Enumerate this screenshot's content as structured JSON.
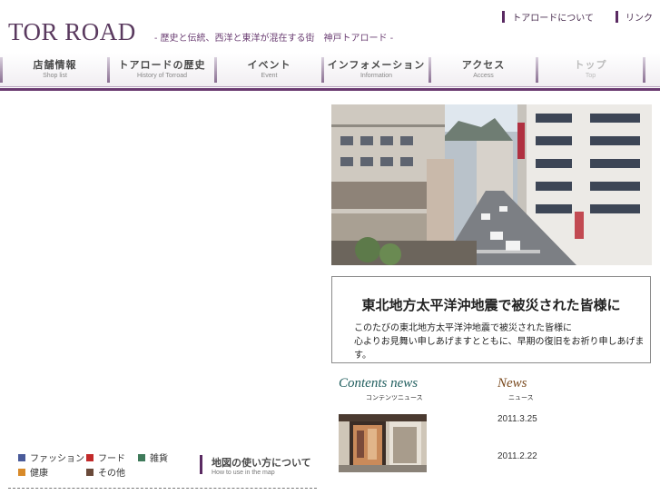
{
  "header": {
    "logo": "TOR ROAD",
    "tagline": "- 歴史と伝統、西洋と東洋が混在する街　神戸トアロード -",
    "links": [
      "トアロードについて",
      "リンク"
    ]
  },
  "nav": [
    {
      "jp": "店舗情報",
      "en": "Shop list"
    },
    {
      "jp": "トアロードの歴史",
      "en": "History of Torroad"
    },
    {
      "jp": "イベント",
      "en": "Event"
    },
    {
      "jp": "インフォメーション",
      "en": "Information"
    },
    {
      "jp": "アクセス",
      "en": "Access"
    },
    {
      "jp": "トップ",
      "en": "Top"
    }
  ],
  "notice": {
    "title": "東北地方太平洋沖地震で被災された皆様に",
    "line1": "このたびの東北地方太平洋沖地震で被災された皆様に",
    "line2": "心よりお見舞い申しあげますとともに、早期の復旧をお祈り申しあげます。"
  },
  "contents_news": {
    "title": "Contents news",
    "subtitle": "コンテンツニュース"
  },
  "news": {
    "title": "News",
    "subtitle": "ニュース",
    "dates": [
      "2011.3.25",
      "2011.2.22"
    ]
  },
  "legend": [
    {
      "label": "ファッション",
      "color": "#4a5b9a"
    },
    {
      "label": "フード",
      "color": "#c22a2a"
    },
    {
      "label": "雑貨",
      "color": "#3f7a5a"
    },
    {
      "label": "健康",
      "color": "#d88a2a"
    },
    {
      "label": "その他",
      "color": "#6a4a3a"
    }
  ],
  "map_howto": {
    "jp": "地図の使い方について",
    "en": "How to use in the map"
  }
}
